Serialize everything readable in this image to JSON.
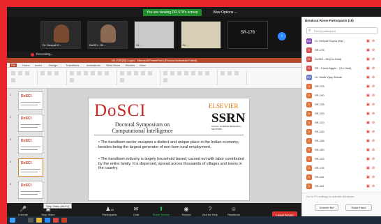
{
  "topbar": {
    "viewing_label": "You are viewing DR.S78's screen",
    "view_options_label": "View Options ⌵"
  },
  "thumbnails": [
    {
      "name": "Dr. Deepali G..."
    },
    {
      "name": "DoSCI - 26 ..."
    },
    {
      "name": "24 ..."
    },
    {
      "name": "Dr. ..."
    }
  ],
  "active_tile": {
    "label": "SR-176"
  },
  "recording": {
    "label": "Recording..."
  },
  "ppt": {
    "title": "M1-CSE(B)L2.pptx - Microsoft PowerPoint (Product Activation Failed)",
    "tabs": [
      "File",
      "Home",
      "Insert",
      "Design",
      "Transitions",
      "Animations",
      "Slide Show",
      "Review",
      "View"
    ]
  },
  "slide": {
    "logo": "DoSCI",
    "subtitle_1": "Doctoral Symposium on",
    "subtitle_2": "Computational Intelligence",
    "elsevier": "ELSEVIER",
    "ssrn": "SSRN",
    "ssrn_tag": "SOCIAL SCIENCE RESEARCH NETWORK",
    "bullets": [
      "The handloom sector occupies a distinct and unique place in the Indian economy, besides being the largest generator of non-farm rural employment.",
      "The handloom industry is largely household based, carried out with labor contributed by the entire family. It is dispersed, spread across thousands of villages and towns in the country."
    ]
  },
  "slide_thumbs": [
    {
      "num": "1"
    },
    {
      "num": "2"
    },
    {
      "num": "3"
    },
    {
      "num": "4"
    },
    {
      "num": "5"
    }
  ],
  "controls": {
    "unmute": "Unmute",
    "stop_video": "Stop Video",
    "participants": "Participants",
    "participants_count": "18",
    "chat": "Chat",
    "share_screen": "Share Screen",
    "record": "Record",
    "ask_for_help": "Ask for Help",
    "reactions": "Reactions",
    "leave_room": "Leave Room",
    "tooltip": "Stop Video (Alt+V)"
  },
  "panel": {
    "title": "Breakout Room Participants (18)",
    "search_placeholder": "Find a participant",
    "participants": [
      {
        "name": "Dr. Deepali Gupta (Me)",
        "color": "#8e4fb8",
        "initial": "DG"
      },
      {
        "name": "SR-176",
        "color": "#d9534f",
        "initial": "S"
      },
      {
        "name": "DoSCI - 26 (Co-Host)",
        "color": "#d9534f",
        "initial": "D"
      },
      {
        "name": "SR - Kunal Aggar... (Co-Host)",
        "color": "#d9534f",
        "initial": "S"
      },
      {
        "name": "Dr. Swati Vijay Shinde",
        "color": "#6d7fc4",
        "initial": "DS"
      },
      {
        "name": "SR-133",
        "color": "#e0713a",
        "initial": "S"
      },
      {
        "name": "SR-140",
        "color": "#e0713a",
        "initial": "S"
      },
      {
        "name": "SR-135",
        "color": "#e0713a",
        "initial": "S"
      },
      {
        "name": "SR-103",
        "color": "#e0713a",
        "initial": "S"
      },
      {
        "name": "SR-120",
        "color": "#e0713a",
        "initial": "S"
      },
      {
        "name": "SR-130",
        "color": "#e0713a",
        "initial": "S"
      },
      {
        "name": "SR-158",
        "color": "#e0713a",
        "initial": "S"
      },
      {
        "name": "SR-150",
        "color": "#e0713a",
        "initial": "S"
      },
      {
        "name": "SR-153",
        "color": "#e0713a",
        "initial": "S"
      },
      {
        "name": "SR-176",
        "color": "#e0713a",
        "initial": "S"
      },
      {
        "name": "SR-112",
        "color": "#e0713a",
        "initial": "S"
      },
      {
        "name": "SR-151",
        "color": "#e0713a",
        "initial": "S"
      }
    ],
    "mute_me": "Unmute Me",
    "raise_hand": "Raise Hand",
    "activate": "Go to PC settings to activate Windows."
  }
}
